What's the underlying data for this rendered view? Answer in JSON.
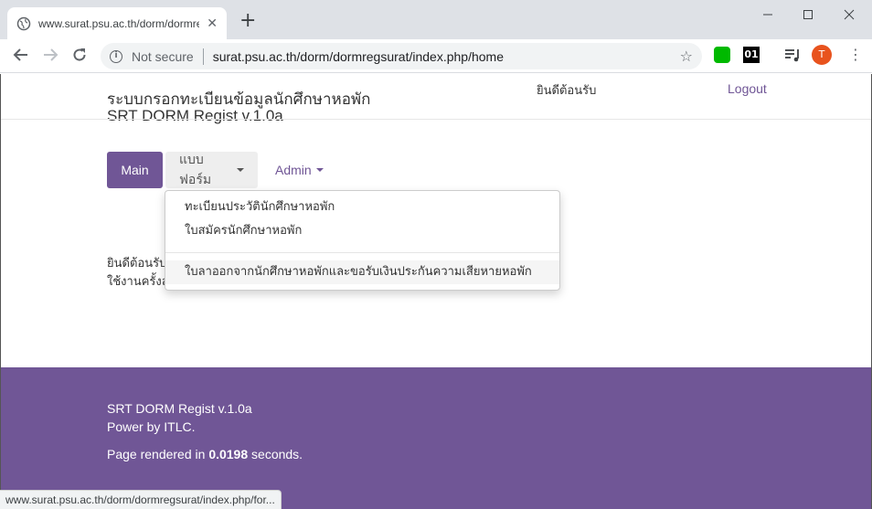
{
  "browser": {
    "tab_title": "www.surat.psu.ac.th/dorm/dormregsurat/index.php/home",
    "new_tab": "+",
    "tab_close": "✕",
    "security_label": "Not secure",
    "url": "surat.psu.ac.th/dorm/dormregsurat/index.php/home",
    "ext_01": "01",
    "avatar_letter": "T",
    "status_url": "www.surat.psu.ac.th/dorm/dormregsurat/index.php/for..."
  },
  "header": {
    "brand_thai": "ระบบกรอกทะเบียนข้อมูลนักศึกษาหอพัก",
    "brand_en": "SRT DORM Regist v.1.0a",
    "welcome": "ยินดีต้อนรับ",
    "logout": "Logout"
  },
  "nav": {
    "main": "Main",
    "forms": "แบบฟอร์ม",
    "admin": "Admin"
  },
  "dropdown": {
    "items": [
      "ทะเบียนประวัตินักศึกษาหอพัก",
      "ใบสมัครนักศึกษาหอพัก",
      "ใบลาออกจากนักศึกษาหอพักและขอรับเงินประกันความเสียหายหอพัก"
    ]
  },
  "content": {
    "line1": "ยินดีต้อนรับ",
    "line2": "ใช้งานครั้งล"
  },
  "footer": {
    "line1": "SRT DORM Regist v.1.0a",
    "line2": "Power by ITLC.",
    "rendered_prefix": "Page rendered in ",
    "rendered_value": "0.0198",
    "rendered_suffix": " seconds."
  },
  "colors": {
    "brand_purple": "#705696"
  }
}
